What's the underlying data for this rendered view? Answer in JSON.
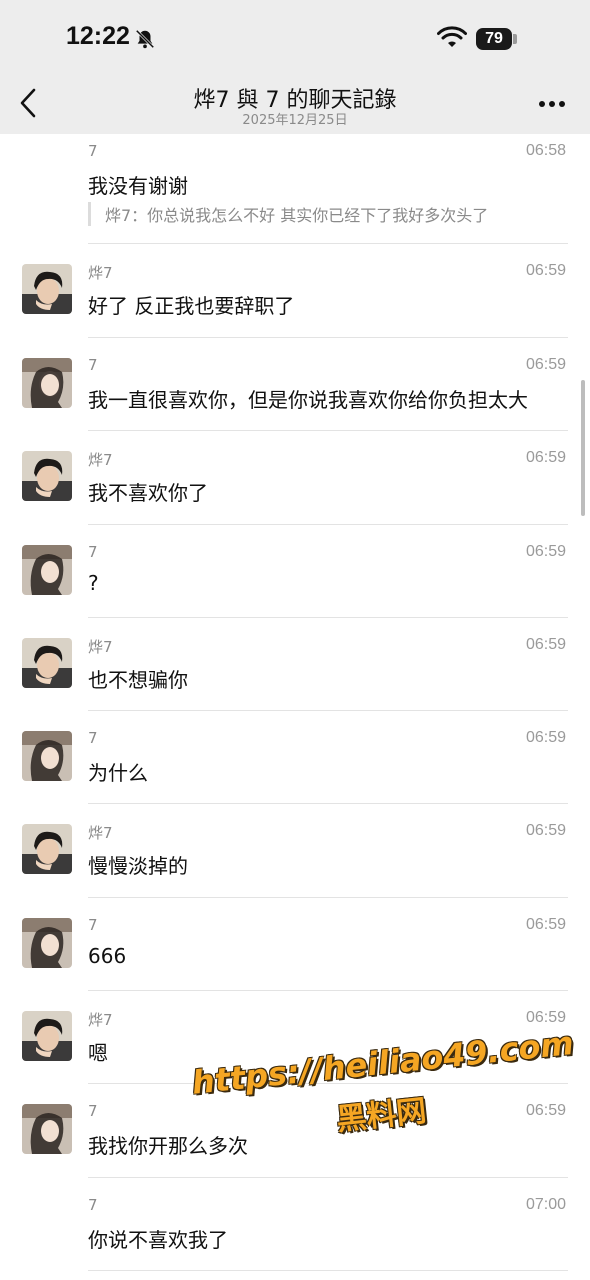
{
  "status_bar": {
    "time": "12:22",
    "battery": "79",
    "bell_icon": "bell-slash-icon",
    "wifi_icon": "wifi-icon"
  },
  "nav": {
    "title": "烨7 與 7 的聊天記錄",
    "subtitle": "2025年12月25日",
    "back_icon": "chevron-left-icon",
    "more_icon": "more-dots-icon"
  },
  "messages": [
    {
      "sender": "7",
      "time": "06:58",
      "text": "我没有谢谢",
      "quote": "烨7：你总说我怎么不好 其实你已经下了我好多次头了",
      "avatar": "none"
    },
    {
      "sender": "烨7",
      "time": "06:59",
      "text": "好了 反正我也要辞职了",
      "avatar": "male"
    },
    {
      "sender": "7",
      "time": "06:59",
      "text": "我一直很喜欢你，但是你说我喜欢你给你负担太大",
      "avatar": "female"
    },
    {
      "sender": "烨7",
      "time": "06:59",
      "text": "我不喜欢你了",
      "avatar": "male"
    },
    {
      "sender": "7",
      "time": "06:59",
      "text": "?",
      "avatar": "female"
    },
    {
      "sender": "烨7",
      "time": "06:59",
      "text": "也不想骗你",
      "avatar": "male"
    },
    {
      "sender": "7",
      "time": "06:59",
      "text": "为什么",
      "avatar": "female"
    },
    {
      "sender": "烨7",
      "time": "06:59",
      "text": "慢慢淡掉的",
      "avatar": "male"
    },
    {
      "sender": "7",
      "time": "06:59",
      "text": "666",
      "avatar": "female"
    },
    {
      "sender": "烨7",
      "time": "06:59",
      "text": "嗯",
      "avatar": "male"
    },
    {
      "sender": "7",
      "time": "06:59",
      "text": "我找你开那么多次",
      "avatar": "female"
    },
    {
      "sender": "7",
      "time": "07:00",
      "text": "你说不喜欢我了",
      "avatar": "none"
    }
  ],
  "watermark": {
    "url": "https://heiliao49.com",
    "name": "黑料网"
  },
  "colors": {
    "topbar_bg": "#ededed",
    "watermark": "#f5a623"
  }
}
